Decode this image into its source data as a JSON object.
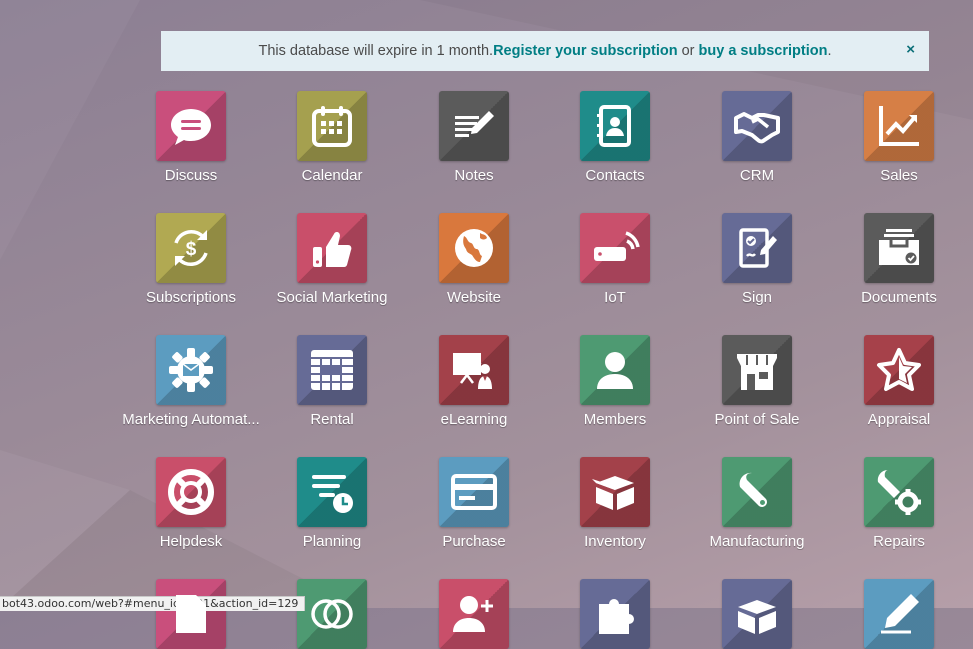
{
  "banner": {
    "text_before": "This database will expire in 1 month. ",
    "register_link": "Register your subscription",
    "text_middle": " or ",
    "buy_link": "buy a subscription",
    "text_after": ".",
    "close_label": "×"
  },
  "apps": [
    {
      "label": "Discuss",
      "icon": "chat-bubble-icon",
      "color": "#c94f7c"
    },
    {
      "label": "Calendar",
      "icon": "calendar-icon",
      "color": "#a5a04f"
    },
    {
      "label": "Notes",
      "icon": "note-pen-icon",
      "color": "#5b5b5b"
    },
    {
      "label": "Contacts",
      "icon": "address-book-icon",
      "color": "#1f8c8a"
    },
    {
      "label": "CRM",
      "icon": "handshake-icon",
      "color": "#666b96"
    },
    {
      "label": "Sales",
      "icon": "trend-chart-icon",
      "color": "#d67f46"
    },
    {
      "label": "Subscriptions",
      "icon": "recurring-dollar-icon",
      "color": "#b1a952"
    },
    {
      "label": "Social Marketing",
      "icon": "thumbs-up-icon",
      "color": "#c94f6a"
    },
    {
      "label": "Website",
      "icon": "globe-icon",
      "color": "#d9783d"
    },
    {
      "label": "IoT",
      "icon": "iot-device-icon",
      "color": "#c9506c"
    },
    {
      "label": "Sign",
      "icon": "signed-document-icon",
      "color": "#666b96"
    },
    {
      "label": "Documents",
      "icon": "inbox-tray-icon",
      "color": "#5b5b5b"
    },
    {
      "label": "Marketing Automat...",
      "icon": "gear-mail-icon",
      "color": "#5c9cc0"
    },
    {
      "label": "Rental",
      "icon": "rental-grid-icon",
      "color": "#666b96"
    },
    {
      "label": "eLearning",
      "icon": "teacher-board-icon",
      "color": "#a3414a"
    },
    {
      "label": "Members",
      "icon": "user-icon",
      "color": "#4e9a72"
    },
    {
      "label": "Point of Sale",
      "icon": "shop-icon",
      "color": "#5b5b5b"
    },
    {
      "label": "Appraisal",
      "icon": "star-icon",
      "color": "#a6414a"
    },
    {
      "label": "Helpdesk",
      "icon": "lifebuoy-icon",
      "color": "#c94f6a"
    },
    {
      "label": "Planning",
      "icon": "planning-clock-icon",
      "color": "#1f8c8a"
    },
    {
      "label": "Purchase",
      "icon": "credit-card-icon",
      "color": "#5c9cc0"
    },
    {
      "label": "Inventory",
      "icon": "box-icon",
      "color": "#a3414a"
    },
    {
      "label": "Manufacturing",
      "icon": "wrench-icon",
      "color": "#4e9a72"
    },
    {
      "label": "Repairs",
      "icon": "wrench-gear-icon",
      "color": "#4e9a72"
    },
    {
      "label": "",
      "icon": "document-icon",
      "color": "#c94f7c"
    },
    {
      "label": "",
      "icon": "venn-circles-icon",
      "color": "#4e9a72"
    },
    {
      "label": "",
      "icon": "user-plus-icon",
      "color": "#c94f6a"
    },
    {
      "label": "",
      "icon": "puzzle-icon",
      "color": "#666b96"
    },
    {
      "label": "",
      "icon": "open-box-icon",
      "color": "#666b96"
    },
    {
      "label": "",
      "icon": "pen-edit-icon",
      "color": "#5c9cc0"
    }
  ],
  "status_url": "bot43.odoo.com/web?#menu_id=101&action_id=129"
}
